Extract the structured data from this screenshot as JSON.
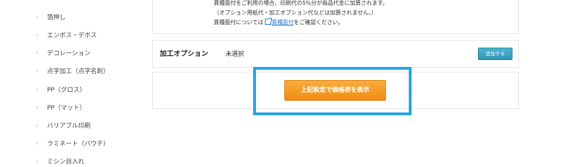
{
  "sidebar": {
    "items": [
      {
        "label": "箔押し"
      },
      {
        "label": "エンボス・デボス"
      },
      {
        "label": "デコレーション"
      },
      {
        "label": "点字加工（点字名刺）"
      },
      {
        "label": "PP（グロス）"
      },
      {
        "label": "PP（マット）"
      },
      {
        "label": "バリアブル印刷"
      },
      {
        "label": "ラミネート（パウチ）"
      },
      {
        "label": "ミシン目入れ"
      }
    ]
  },
  "notice": {
    "line1": "異種面付をご利用の場合、印刷代の5%分が商品代金に加算されます。",
    "line2": "（オプション用紙代・加工オプション代などは加算されません。）",
    "line3_prefix": "異種面付については",
    "line3_link": "異種面付",
    "line3_suffix": "をご確認ください。"
  },
  "processing_option": {
    "title": "加工オプション",
    "value": "未選択",
    "add_button": "追加する"
  },
  "price": {
    "button": "上記設定で価格表を表示"
  },
  "colors": {
    "accent_orange": "#f39c1f",
    "accent_teal": "#3aa3c2",
    "highlight_blue": "#23a3e6",
    "link_blue": "#2a7ad8"
  }
}
